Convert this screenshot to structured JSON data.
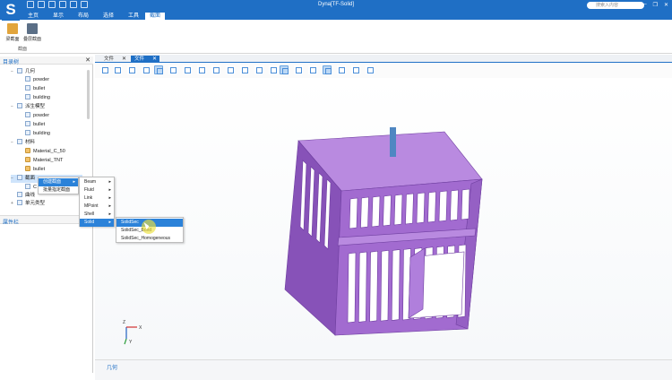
{
  "app": {
    "logo_letter": "S",
    "window_title": "Dyna[TF-Solid]",
    "search_placeholder": "搜索入内容",
    "window_controls": [
      "—",
      "❐",
      "✕"
    ]
  },
  "ribbon": {
    "tabs": [
      {
        "label": "主页",
        "active": false
      },
      {
        "label": "显示",
        "active": false
      },
      {
        "label": "布局",
        "active": false
      },
      {
        "label": "选择",
        "active": false
      },
      {
        "label": "工具",
        "active": false
      },
      {
        "label": "截面",
        "active": true
      }
    ],
    "buttons": [
      {
        "label": "梁截面",
        "color": "#e2a53c"
      },
      {
        "label": "叠层截面",
        "color": "#5b6f86"
      }
    ],
    "group_label": "截面"
  },
  "tree_panel": {
    "title": "目录树",
    "close": "✕",
    "items": [
      {
        "label": "几何",
        "toggle": "−",
        "level": 1,
        "selected": false
      },
      {
        "label": "powder",
        "toggle": "",
        "level": 2,
        "selected": false
      },
      {
        "label": "bullet",
        "toggle": "",
        "level": 2,
        "selected": false
      },
      {
        "label": "building",
        "toggle": "",
        "level": 2,
        "selected": false
      },
      {
        "label": "派生模型",
        "toggle": "−",
        "level": 1,
        "selected": false
      },
      {
        "label": "powder",
        "toggle": "",
        "level": 2,
        "selected": false
      },
      {
        "label": "bullet",
        "toggle": "",
        "level": 2,
        "selected": false
      },
      {
        "label": "building",
        "toggle": "",
        "level": 2,
        "selected": false
      },
      {
        "label": "材料",
        "toggle": "−",
        "level": 1,
        "selected": false
      },
      {
        "label": "Material_C_50",
        "toggle": "",
        "level": 2,
        "selected": false
      },
      {
        "label": "Material_TNT",
        "toggle": "",
        "level": 2,
        "selected": false
      },
      {
        "label": "bullet",
        "toggle": "",
        "level": 2,
        "selected": false
      },
      {
        "label": "截面",
        "toggle": "−",
        "level": 1,
        "selected": true
      },
      {
        "label": "C",
        "toggle": "",
        "level": 2,
        "selected": false
      },
      {
        "label": "曲线",
        "toggle": "",
        "level": 1,
        "selected": false
      },
      {
        "label": "单元类型",
        "toggle": "+",
        "level": 1,
        "selected": false
      }
    ]
  },
  "props_panel": {
    "title": "属性栏"
  },
  "doc_tabs": [
    {
      "label": "文件",
      "active": false
    },
    {
      "label": "文件",
      "active": true
    }
  ],
  "tab_close": "✕",
  "context_menu": {
    "level1": [
      {
        "label": "创建截面",
        "highlighted": true,
        "has_sub": true
      },
      {
        "label": "批量指定截面",
        "highlighted": false,
        "has_sub": false
      }
    ],
    "level2": [
      {
        "label": "Beam",
        "highlighted": false
      },
      {
        "label": "Fluid",
        "highlighted": false
      },
      {
        "label": "Link",
        "highlighted": false
      },
      {
        "label": "MPoint",
        "highlighted": false
      },
      {
        "label": "Shell",
        "highlighted": false
      },
      {
        "label": "Solid",
        "highlighted": true
      }
    ],
    "level3": [
      {
        "label": "SolidSec",
        "highlighted": true
      },
      {
        "label": "SolidSec_Bond",
        "highlighted": false
      },
      {
        "label": "SolidSec_Homogeneous",
        "highlighted": false
      }
    ],
    "submenu_arrow": "▸"
  },
  "triad": {
    "z": "Z",
    "x": "X",
    "y": "Y"
  },
  "status": {
    "label": "几何"
  },
  "colors": {
    "brand": "#1f6fc5",
    "model_face": "#a26bd0",
    "model_side": "#8752b8",
    "model_top": "#b98ae0",
    "post": "#4f87c2",
    "menu_highlight": "#2b82d9"
  }
}
